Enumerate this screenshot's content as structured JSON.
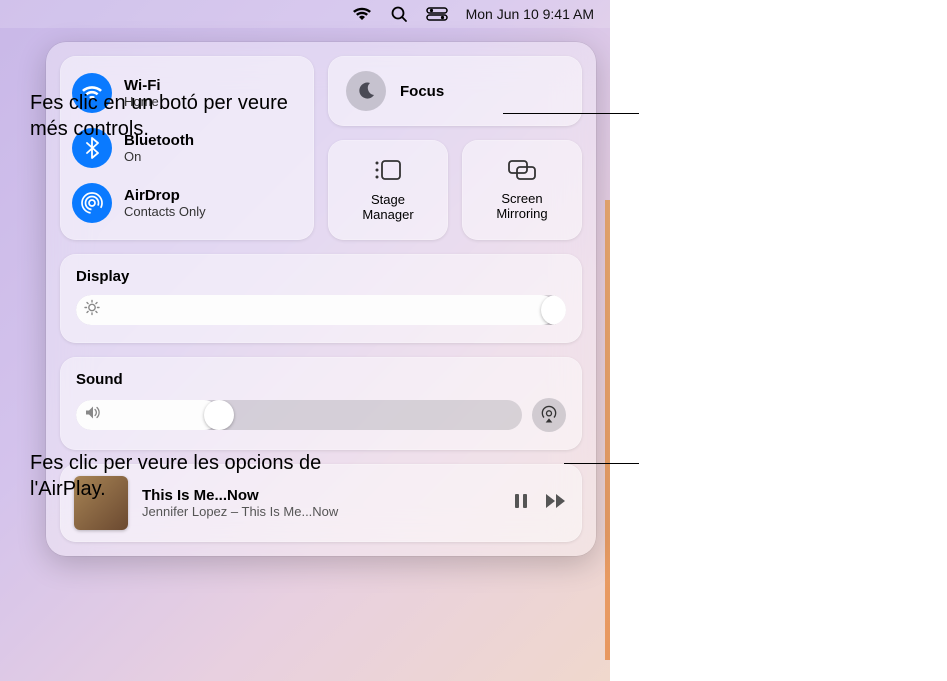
{
  "menubar": {
    "datetime": "Mon Jun 10  9:41 AM"
  },
  "connectivity": {
    "wifi": {
      "title": "Wi-Fi",
      "subtitle": "Home",
      "on": true
    },
    "bt": {
      "title": "Bluetooth",
      "subtitle": "On",
      "on": true
    },
    "airdrop": {
      "title": "AirDrop",
      "subtitle": "Contacts Only",
      "on": true
    }
  },
  "focus": {
    "title": "Focus"
  },
  "stage": {
    "label": "Stage\nManager"
  },
  "mirror": {
    "label": "Screen\nMirroring"
  },
  "display": {
    "title": "Display",
    "value_pct": 98
  },
  "sound": {
    "title": "Sound",
    "value_pct": 32
  },
  "now_playing": {
    "title": "This Is Me...Now",
    "subtitle": "Jennifer Lopez – This Is Me...Now"
  },
  "annotations": {
    "a1": "Fes clic en un botó per veure més controls.",
    "a2": "Fes clic per veure les opcions de l'AirPlay."
  }
}
